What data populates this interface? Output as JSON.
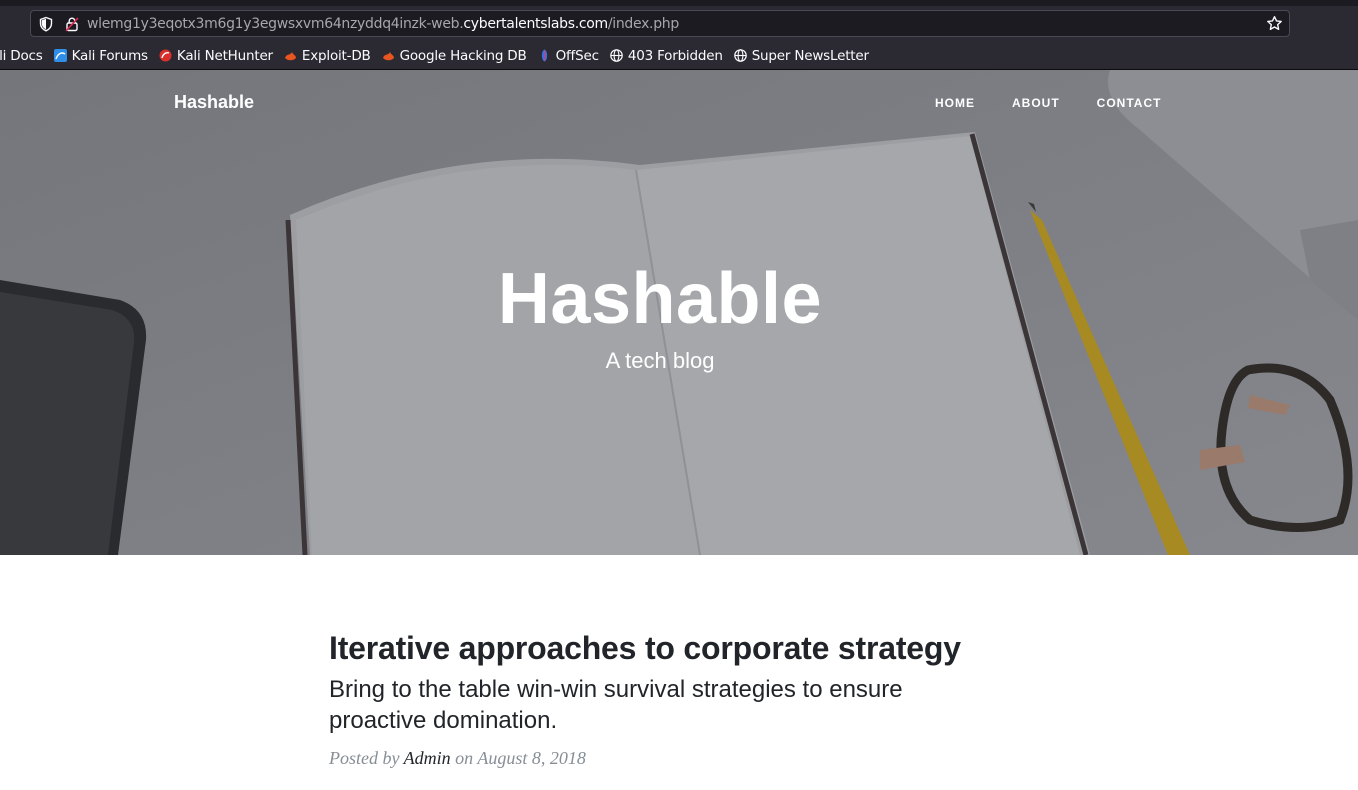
{
  "browser": {
    "url_prefix": "wlemg1y3eqotx3m6g1y3egwsxvm64nzyddq4inzk-web.",
    "url_host": "cybertalentslabs.com",
    "url_path": "/index.php",
    "bookmarks": [
      {
        "label": "ali Docs",
        "icon": "kali-docs-icon"
      },
      {
        "label": "Kali Forums",
        "icon": "kali-forums-icon"
      },
      {
        "label": "Kali NetHunter",
        "icon": "kali-nethunter-icon"
      },
      {
        "label": "Exploit-DB",
        "icon": "exploit-db-icon"
      },
      {
        "label": "Google Hacking DB",
        "icon": "ghdb-icon"
      },
      {
        "label": "OffSec",
        "icon": "offsec-icon"
      },
      {
        "label": "403 Forbidden",
        "icon": "globe-icon"
      },
      {
        "label": "Super NewsLetter",
        "icon": "globe-icon"
      }
    ]
  },
  "site": {
    "brand": "Hashable",
    "nav": {
      "home": "HOME",
      "about": "ABOUT",
      "contact": "CONTACT"
    },
    "hero_title": "Hashable",
    "hero_subtitle": "A tech blog"
  },
  "post": {
    "title": "Iterative approaches to corporate strategy",
    "subtitle": "Bring to the table win-win survival strategies to ensure proactive domination.",
    "meta_prefix": "Posted by",
    "author": "Admin",
    "meta_on": "on August 8, 2018"
  },
  "colors": {
    "chrome_bg": "#2b2a33",
    "urlbar_bg": "#1c1b22",
    "hero_overlay": "#6f7177",
    "text_dark": "#212529",
    "meta_gray": "#868e96"
  }
}
